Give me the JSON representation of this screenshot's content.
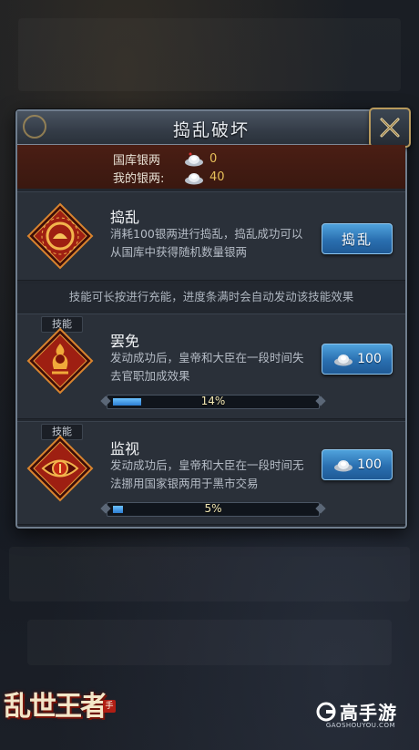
{
  "dialog": {
    "title": "捣乱破坏",
    "close_icon": "close-x-icon"
  },
  "resources": {
    "treasury_label": "国库银两",
    "treasury_value": "0",
    "mine_label": "我的银两:",
    "mine_value": "40",
    "icon": "silver-ingot-icon"
  },
  "skills_notice": "技能可长按进行充能，进度条满时会自动发动该技能效果",
  "cards": [
    {
      "title": "捣乱",
      "desc": "消耗100银两进行捣乱，捣乱成功可以从国库中获得随机数量银两",
      "button": "捣乱",
      "icon": "disturb-emblem-icon"
    },
    {
      "tag": "技能",
      "title": "罢免",
      "desc": "发动成功后，皇帝和大臣在一段时间失去官职加成效果",
      "cost": "100",
      "progress": 0.14,
      "progress_text": "14%",
      "icon": "dismiss-emblem-icon"
    },
    {
      "tag": "技能",
      "title": "监视",
      "desc": "发动成功后，皇帝和大臣在一段时间无法挪用国家银两用于黑市交易",
      "cost": "100",
      "progress": 0.05,
      "progress_text": "5%",
      "icon": "eye-emblem-icon"
    }
  ],
  "branding": {
    "game_logo": "乱世王者",
    "game_logo_badge": "手",
    "site_name": "高手游",
    "site_url": "GAOSHOUYOU.COM"
  },
  "colors": {
    "accent_gold": "#b89a5d",
    "button_blue": "#2a6fb0",
    "value_gold": "#e7c05a",
    "resource_bg": "#4a1e14"
  }
}
